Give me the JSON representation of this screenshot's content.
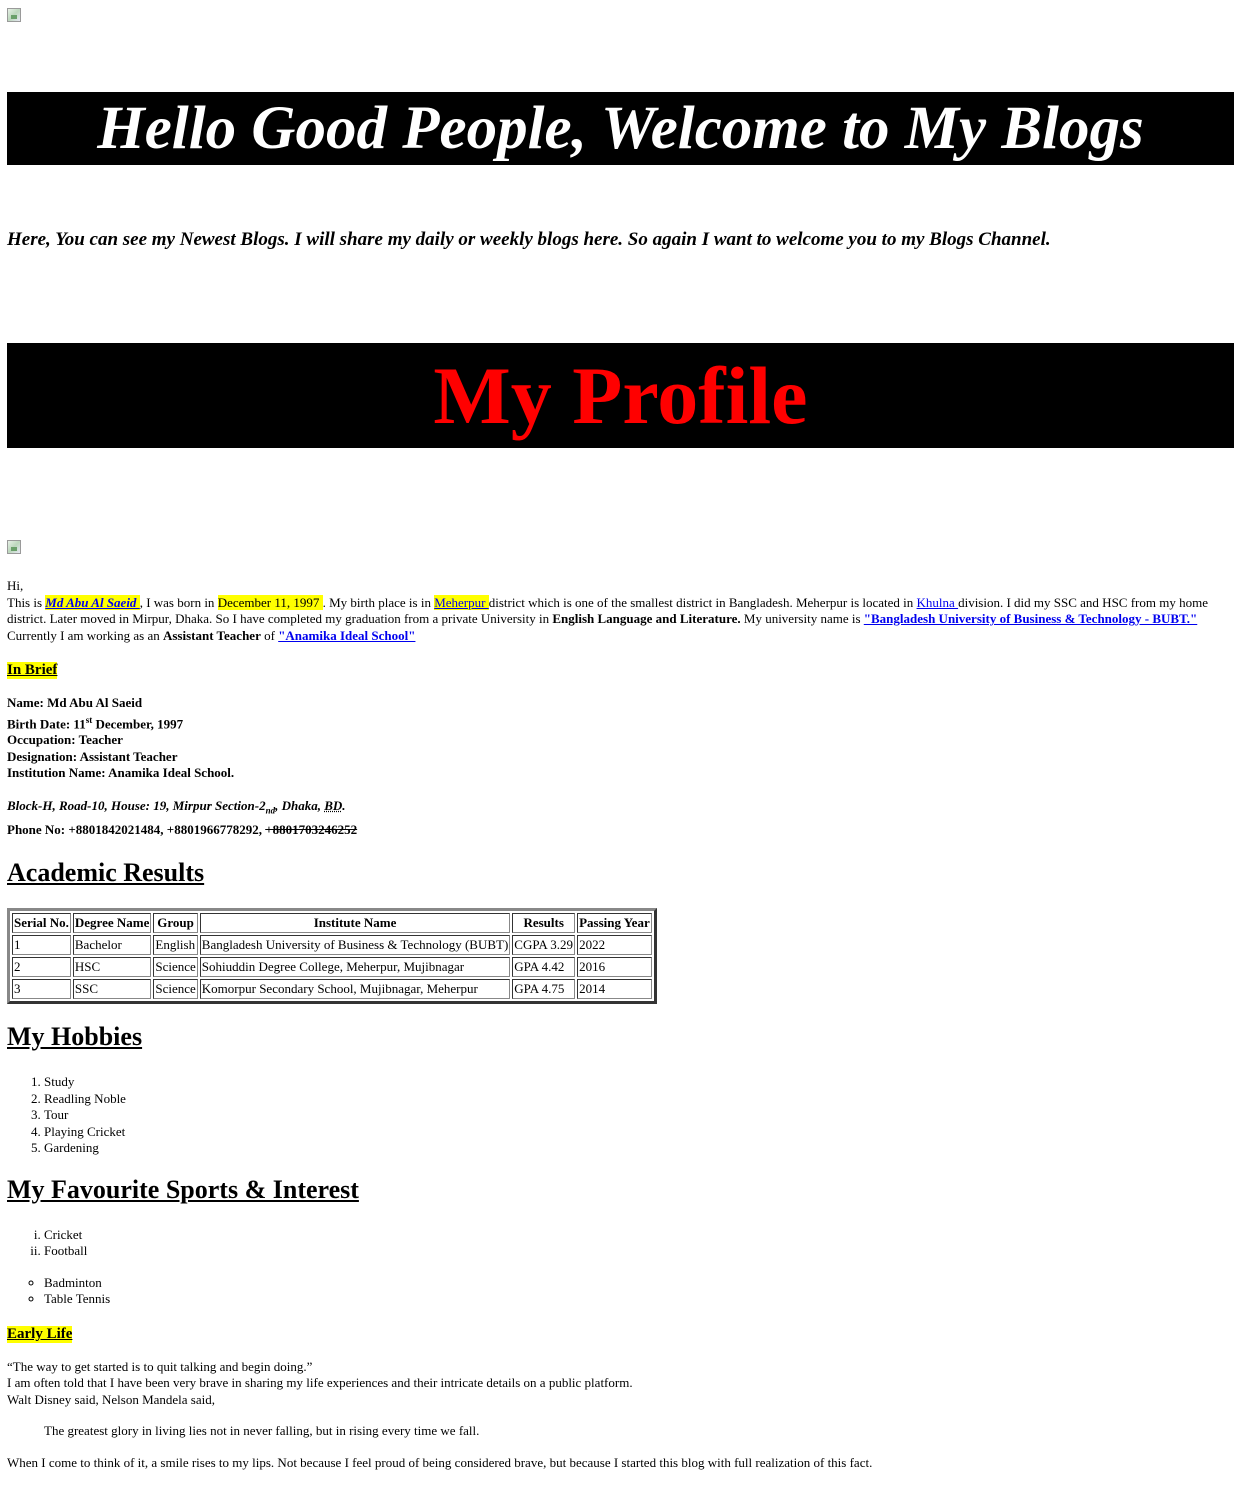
{
  "header": {
    "welcome_banner": "Hello Good People, Welcome to My Blogs",
    "intro_text": "Here, You can see my Newest Blogs. I will share my daily or weekly blogs here. So again I want to welcome you to my Blogs Channel.",
    "profile_banner": "My Profile"
  },
  "bio": {
    "greeting": "Hi,",
    "p1": "This is ",
    "name_link": "Md Abu Al Saeid ",
    "p2": ", I was born in ",
    "birth_date": "December 11, 1997 ",
    "p3": ". My birth place is in ",
    "birthplace_link": "Meherpur ",
    "p4": "district which is one of the smallest district in Bangladesh. Meherpur is located in ",
    "division_link": "Khulna ",
    "p5": "division. I did my SSC and HSC from my home district. Later moved in Mirpur, Dhaka. So I have completed my graduation from a private University in ",
    "subject": "English Language and Literature.",
    "p6": " My university name is ",
    "university_link": "\"Bangladesh University of Business & Technology - BUBT.\" ",
    "p7": " Currently I am working as an ",
    "position": "Assistant Teacher",
    "p8": " of ",
    "school_link": "\"Anamika Ideal School\""
  },
  "brief": {
    "label": "In Brief",
    "name": "Name: Md Abu Al Saeid",
    "birth_prefix": "Birth Date: 11",
    "birth_sup": "st",
    "birth_suffix": " December, 1997",
    "occupation": "Occupation: Teacher",
    "designation": "Designation: Assistant Teacher",
    "institution": "Institution Name: Anamika Ideal School.",
    "address_prefix": "Block-H, Road-10, House: 19, Mirpur Section-2",
    "address_sub": "nd",
    "address_suffix": ", Dhaka, ",
    "address_country": "BD",
    "address_end": ".",
    "phone_prefix": "Phone No: +8801842021484, +8801966778292, ",
    "phone_struck": "+8801703246252"
  },
  "academic": {
    "heading": "Academic Results",
    "columns": [
      "Serial No.",
      "Degree Name",
      "Group",
      "Institute Name",
      "Results",
      "Passing Year"
    ],
    "rows": [
      [
        "1",
        "Bachelor",
        "English",
        "Bangladesh University of Business & Technology (BUBT)",
        "CGPA 3.29",
        "2022"
      ],
      [
        "2",
        "HSC",
        "Science",
        "Sohiuddin Degree College, Meherpur, Mujibnagar",
        "GPA 4.42",
        "2016"
      ],
      [
        "3",
        "SSC",
        "Science",
        "Komorpur Secondary School, Mujibnagar, Meherpur",
        "GPA 4.75",
        "2014"
      ]
    ]
  },
  "hobbies": {
    "heading": "My Hobbies",
    "items": [
      "Study",
      "Readling Noble",
      "Tour",
      "Playing Cricket",
      "Gardening"
    ]
  },
  "sports": {
    "heading": "My Favourite Sports & Interest",
    "roman_items": [
      "Cricket",
      "Football"
    ],
    "circle_items": [
      "Badminton",
      "Table Tennis"
    ]
  },
  "early_life": {
    "label": "Early Life",
    "quote": "“The way to get started is to quit talking and begin doing.”",
    "line2": "I am often told that I have been very brave in sharing my life experiences and their intricate details on a public platform.",
    "line3": "Walt Disney said, Nelson Mandela said,",
    "blockquote": "The greatest glory in living lies not in never falling, but in rising every time we fall.",
    "closing": "When I come to think of it, a smile rises to my lips. Not because I feel proud of being considered brave, but because I started this blog with full realization of this fact."
  }
}
